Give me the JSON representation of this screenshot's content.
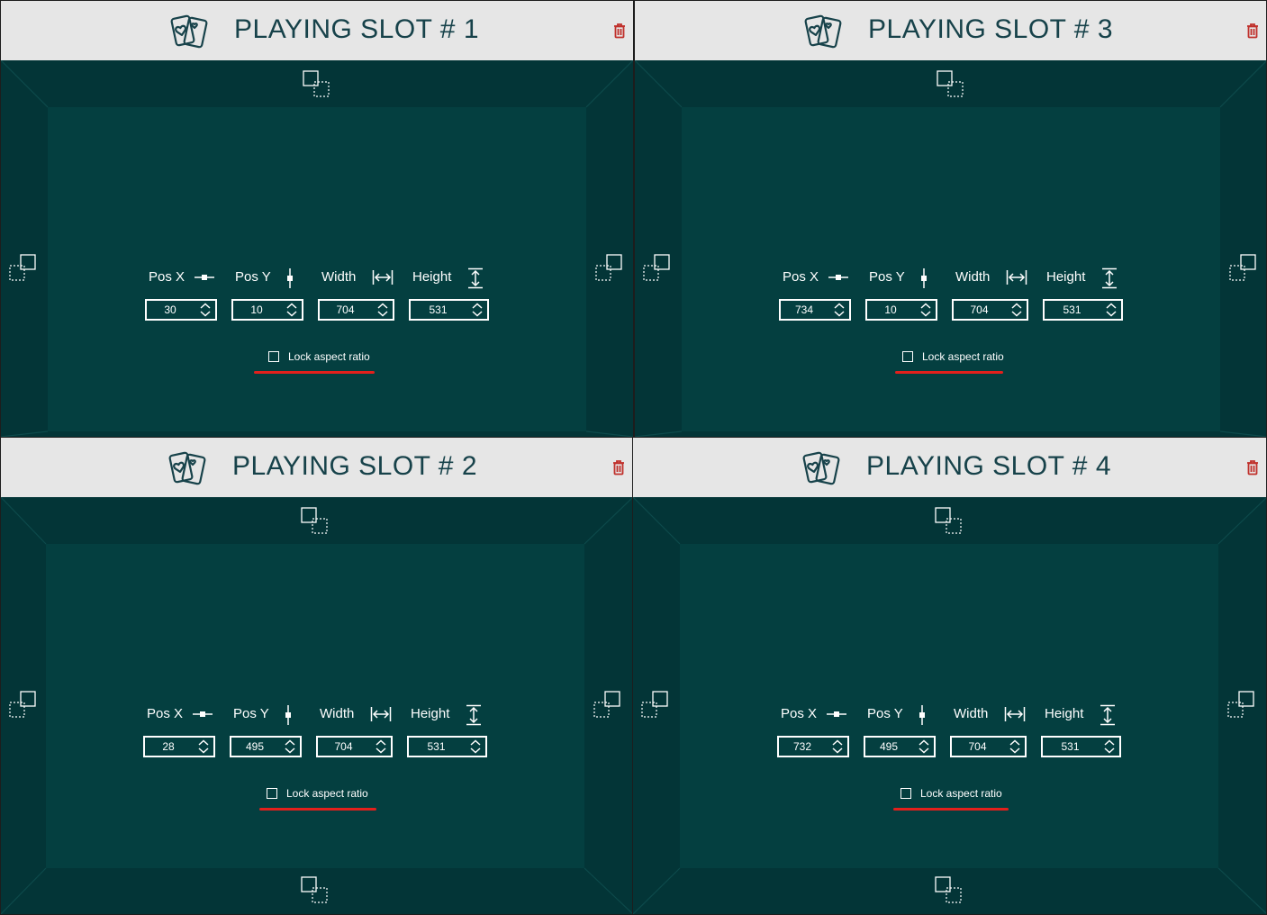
{
  "slots": [
    {
      "title": "PLAYING SLOT # 1",
      "pos_x_label": "Pos X",
      "pos_y_label": "Pos Y",
      "width_label": "Width",
      "height_label": "Height",
      "pos_x": "30",
      "pos_y": "10",
      "width": "704",
      "height": "531",
      "lock_label": "Lock aspect ratio",
      "lock_checked": false
    },
    {
      "title": "PLAYING SLOT # 3",
      "pos_x_label": "Pos X",
      "pos_y_label": "Pos Y",
      "width_label": "Width",
      "height_label": "Height",
      "pos_x": "734",
      "pos_y": "10",
      "width": "704",
      "height": "531",
      "lock_label": "Lock aspect ratio",
      "lock_checked": false
    },
    {
      "title": "PLAYING SLOT # 2",
      "pos_x_label": "Pos X",
      "pos_y_label": "Pos Y",
      "width_label": "Width",
      "height_label": "Height",
      "pos_x": "28",
      "pos_y": "495",
      "width": "704",
      "height": "531",
      "lock_label": "Lock aspect ratio",
      "lock_checked": false
    },
    {
      "title": "PLAYING SLOT # 4",
      "pos_x_label": "Pos X",
      "pos_y_label": "Pos Y",
      "width_label": "Width",
      "height_label": "Height",
      "pos_x": "732",
      "pos_y": "495",
      "width": "704",
      "height": "531",
      "lock_label": "Lock aspect ratio",
      "lock_checked": false
    }
  ],
  "icons": {
    "header": "playing-cards-icon",
    "delete": "trash-icon",
    "anchor": "anchor-overlap-squares-icon",
    "pos_x": "horizontal-position-icon",
    "pos_y": "vertical-position-icon",
    "width": "width-arrows-icon",
    "height": "height-arrows-icon",
    "spin": "spinner-arrows-icon"
  },
  "colors": {
    "header_bg": "#e6e6e6",
    "title_text": "#17424a",
    "body_outer": "#033537",
    "body_inner": "#043f40",
    "delete_icon": "#c0302b",
    "underline": "#e2201c",
    "control_fg": "#ffffff"
  }
}
